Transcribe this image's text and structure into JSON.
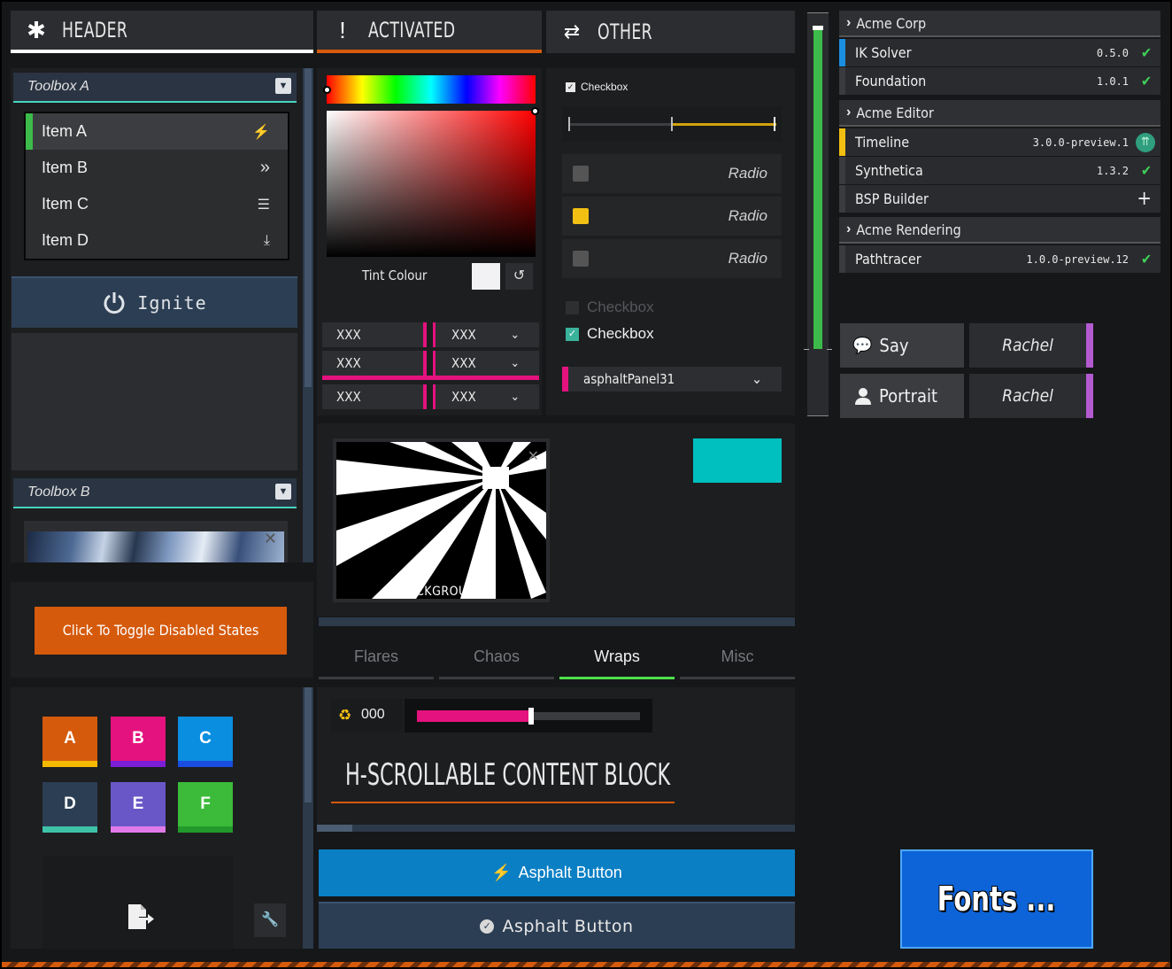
{
  "header": {
    "tabs": [
      {
        "icon": "asterisk-icon",
        "label": "HEADER"
      },
      {
        "icon": "exclamation-icon",
        "label": "ACTIVATED"
      },
      {
        "icon": "swap-arrows-icon",
        "label": "OTHER"
      }
    ]
  },
  "toolbox_a": {
    "title": "Toolbox A",
    "items": [
      {
        "label": "Item A",
        "icon": "lightning-icon"
      },
      {
        "label": "Item B",
        "icon": "double-chevron-right-icon"
      },
      {
        "label": "Item C",
        "icon": "hamburger-icon"
      },
      {
        "label": "Item D",
        "icon": "download-icon"
      }
    ],
    "ignite_label": "Ignite"
  },
  "toolbox_b": {
    "title": "Toolbox B"
  },
  "toggle_button": "Click To Toggle Disabled States",
  "tiles": [
    "A",
    "B",
    "C",
    "D",
    "E",
    "F"
  ],
  "color_picker": {
    "tint_label": "Tint Colour",
    "tint_color": "#f2f2f4",
    "inputs": [
      "XXX",
      "XXX",
      "XXX"
    ],
    "selects": [
      "XXX",
      "XXX",
      "XXX"
    ]
  },
  "other": {
    "small_checkbox_label": "Checkbox",
    "radios": [
      "Radio",
      "Radio",
      "Radio"
    ],
    "checkbox_disabled_label": "Checkbox",
    "checkbox_label": "Checkbox",
    "dropdown_value": "asphaltPanel31"
  },
  "image_label": "BACKGROUND",
  "tabs": [
    {
      "label": "Flares",
      "active": false
    },
    {
      "label": "Chaos",
      "active": false
    },
    {
      "label": "Wraps",
      "active": true
    },
    {
      "label": "Misc",
      "active": false
    }
  ],
  "counter": {
    "value": "000",
    "slider_fraction": 0.5
  },
  "scroll_title": "H-SCROLLABLE CONTENT BLOCK",
  "asphalt_buttons": [
    "Asphalt Button",
    "Asphalt Button"
  ],
  "packages": {
    "groups": [
      {
        "name": "Acme Corp",
        "items": [
          {
            "name": "IK Solver",
            "version": "0.5.0",
            "status": "check"
          },
          {
            "name": "Foundation",
            "version": "1.0.1",
            "status": "check"
          }
        ]
      },
      {
        "name": "Acme Editor",
        "items": [
          {
            "name": "Timeline",
            "version": "3.0.0-preview.1",
            "status": "upgrade"
          },
          {
            "name": "Synthetica",
            "version": "1.3.2",
            "status": "check"
          },
          {
            "name": "BSP Builder",
            "version": "",
            "status": "add"
          }
        ]
      },
      {
        "name": "Acme Rendering",
        "items": [
          {
            "name": "Pathtracer",
            "version": "1.0.0-preview.12",
            "status": "check"
          }
        ]
      }
    ]
  },
  "vertical_slider_fraction": 0.97,
  "dialogue": [
    {
      "action": "Say",
      "icon": "speech-bubble-icon",
      "speaker": "Rachel"
    },
    {
      "action": "Portrait",
      "icon": "person-icon",
      "speaker": "Rachel"
    }
  ],
  "fonts_button": "Fonts ...",
  "colors": {
    "accent_orange": "#d55a0c",
    "accent_blue": "#0a7fc4",
    "accent_pink": "#e4127e",
    "accent_teal": "#00bfbf",
    "accent_green": "#3cbb4a"
  }
}
